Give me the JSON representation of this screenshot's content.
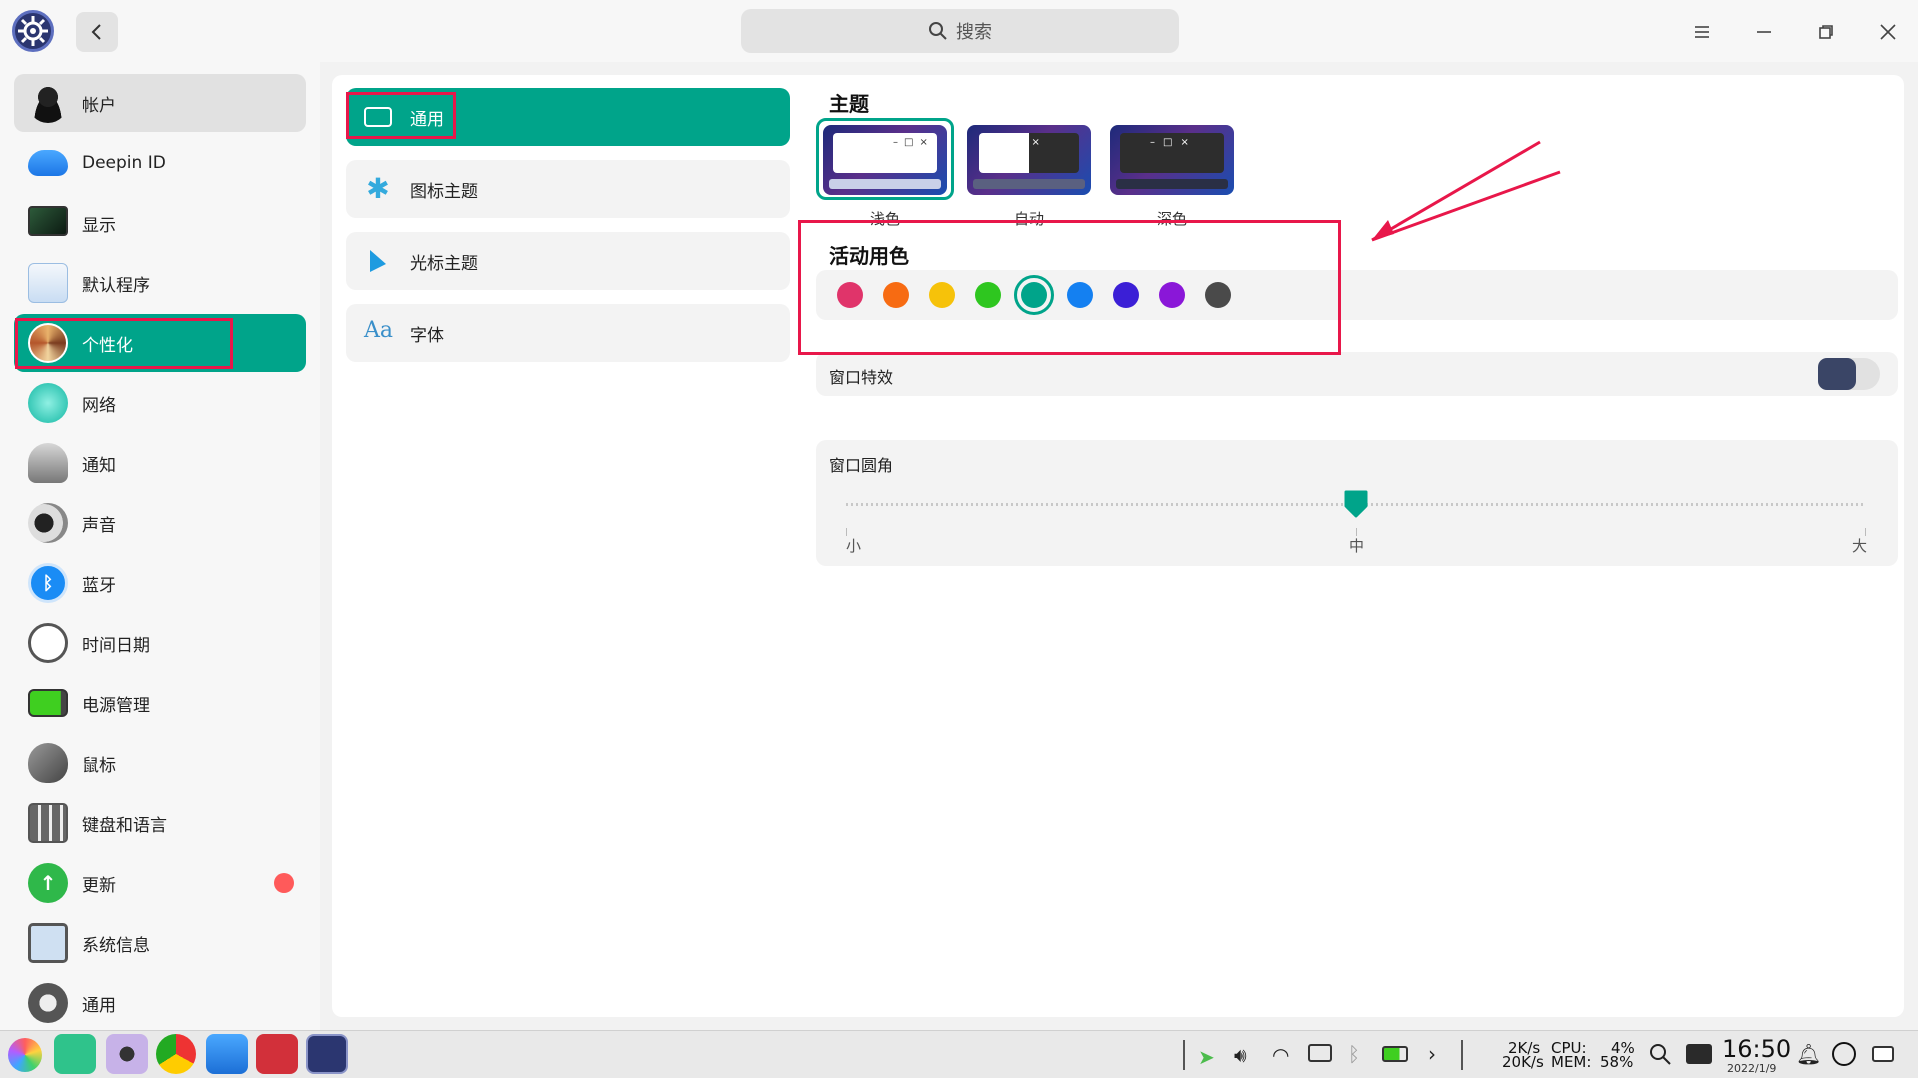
{
  "header": {
    "search_placeholder": "搜索"
  },
  "sidebar": {
    "items": [
      {
        "label": "帐户",
        "icon": "account-icon"
      },
      {
        "label": "Deepin ID",
        "icon": "cloud-icon"
      },
      {
        "label": "显示",
        "icon": "display-icon"
      },
      {
        "label": "默认程序",
        "icon": "default-apps-icon"
      },
      {
        "label": "个性化",
        "icon": "personalization-icon"
      },
      {
        "label": "网络",
        "icon": "network-icon"
      },
      {
        "label": "通知",
        "icon": "bell-icon"
      },
      {
        "label": "声音",
        "icon": "speaker-icon"
      },
      {
        "label": "蓝牙",
        "icon": "bluetooth-icon"
      },
      {
        "label": "时间日期",
        "icon": "clock-icon"
      },
      {
        "label": "电源管理",
        "icon": "battery-icon"
      },
      {
        "label": "鼠标",
        "icon": "mouse-icon"
      },
      {
        "label": "键盘和语言",
        "icon": "keyboard-icon"
      },
      {
        "label": "更新",
        "icon": "update-icon"
      },
      {
        "label": "系统信息",
        "icon": "system-info-icon"
      },
      {
        "label": "通用",
        "icon": "general-icon"
      }
    ]
  },
  "subnav": {
    "items": [
      {
        "label": "通用",
        "icon": "window-icon"
      },
      {
        "label": "图标主题",
        "icon": "flower-icon"
      },
      {
        "label": "光标主题",
        "icon": "cursor-icon"
      },
      {
        "label": "字体",
        "icon": "font-icon",
        "glyph": "Aa"
      }
    ]
  },
  "settings": {
    "theme_title": "主题",
    "themes": [
      {
        "label": "浅色"
      },
      {
        "label": "自动"
      },
      {
        "label": "深色"
      }
    ],
    "accent_title": "活动用色",
    "accent_colors": [
      "#e0346a",
      "#f76b12",
      "#f6c20a",
      "#2ec61f",
      "#00a48a",
      "#1480f1",
      "#3b1fd6",
      "#8a17d8",
      "#4a4a4a"
    ],
    "accent_selected_index": 4,
    "window_effect_label": "窗口特效",
    "window_effect_enabled": true,
    "corner_label": "窗口圆角",
    "corner_marks": [
      "小",
      "中",
      "大"
    ],
    "corner_value": 0.5
  },
  "taskbar": {
    "net_up": "2K/s",
    "net_down": "20K/s",
    "cpu_label": "CPU:",
    "cpu_value": "4%",
    "mem_label": "MEM:",
    "mem_value": "58%",
    "time": "16:50",
    "date": "2022/1/9"
  },
  "colors": {
    "accent": "#00a48a",
    "annotation": "#e8174a"
  }
}
